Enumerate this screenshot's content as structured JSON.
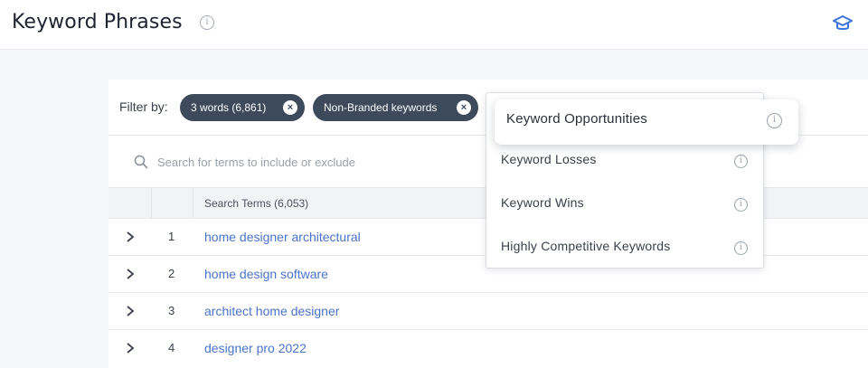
{
  "header": {
    "title": "Keyword Phrases",
    "info_icon": "info-icon",
    "action_icon": "graduation-cap-icon",
    "accent_color": "#3b73d8"
  },
  "filters": {
    "label": "Filter by:",
    "chips": [
      {
        "label": "3 words (6,861)",
        "remove_icon": "close-circle-icon"
      },
      {
        "label": "Non-Branded keywords",
        "remove_icon": "close-circle-icon"
      }
    ],
    "chip_color": "#3d4a5c"
  },
  "search": {
    "icon": "search-icon",
    "placeholder": "Search for terms to include or exclude",
    "value": ""
  },
  "table": {
    "header": {
      "terms": "Search Terms (6,053)"
    },
    "rows": [
      {
        "num": "1",
        "term": "home designer architectural"
      },
      {
        "num": "2",
        "term": "home design software"
      },
      {
        "num": "3",
        "term": "architect home designer"
      },
      {
        "num": "4",
        "term": "designer pro 2022"
      }
    ],
    "link_color": "#4a74c9"
  },
  "dropdown": {
    "selected": "Keyword Opportunities",
    "options": [
      {
        "label": "Keyword Losses"
      },
      {
        "label": "Keyword Wins"
      },
      {
        "label": "Highly Competitive Keywords"
      }
    ]
  }
}
